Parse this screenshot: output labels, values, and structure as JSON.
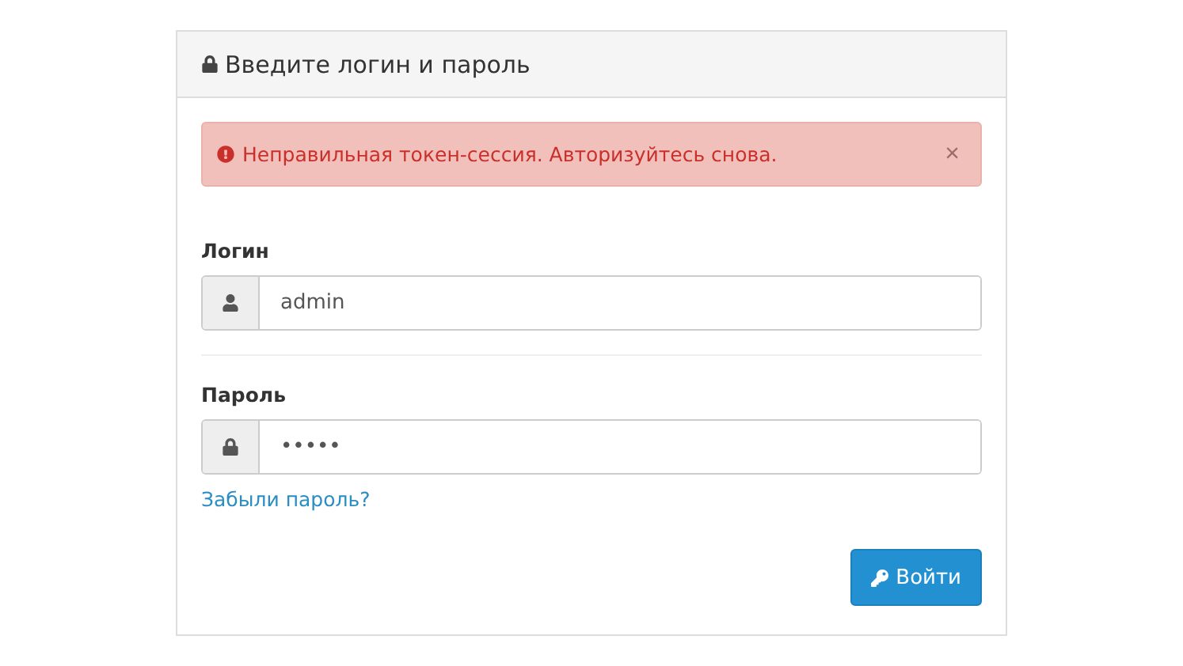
{
  "panel": {
    "title": "Введите логин и пароль"
  },
  "alert": {
    "message": "Неправильная токен-сессия. Авторизуйтесь снова.",
    "close": "×"
  },
  "fields": [
    {
      "label": "Логин",
      "kind": "username",
      "value": "admin"
    },
    {
      "label": "Пароль",
      "kind": "password",
      "value": "•••••"
    }
  ],
  "forgot_link": "Забыли пароль?",
  "submit_button": "Войти"
}
